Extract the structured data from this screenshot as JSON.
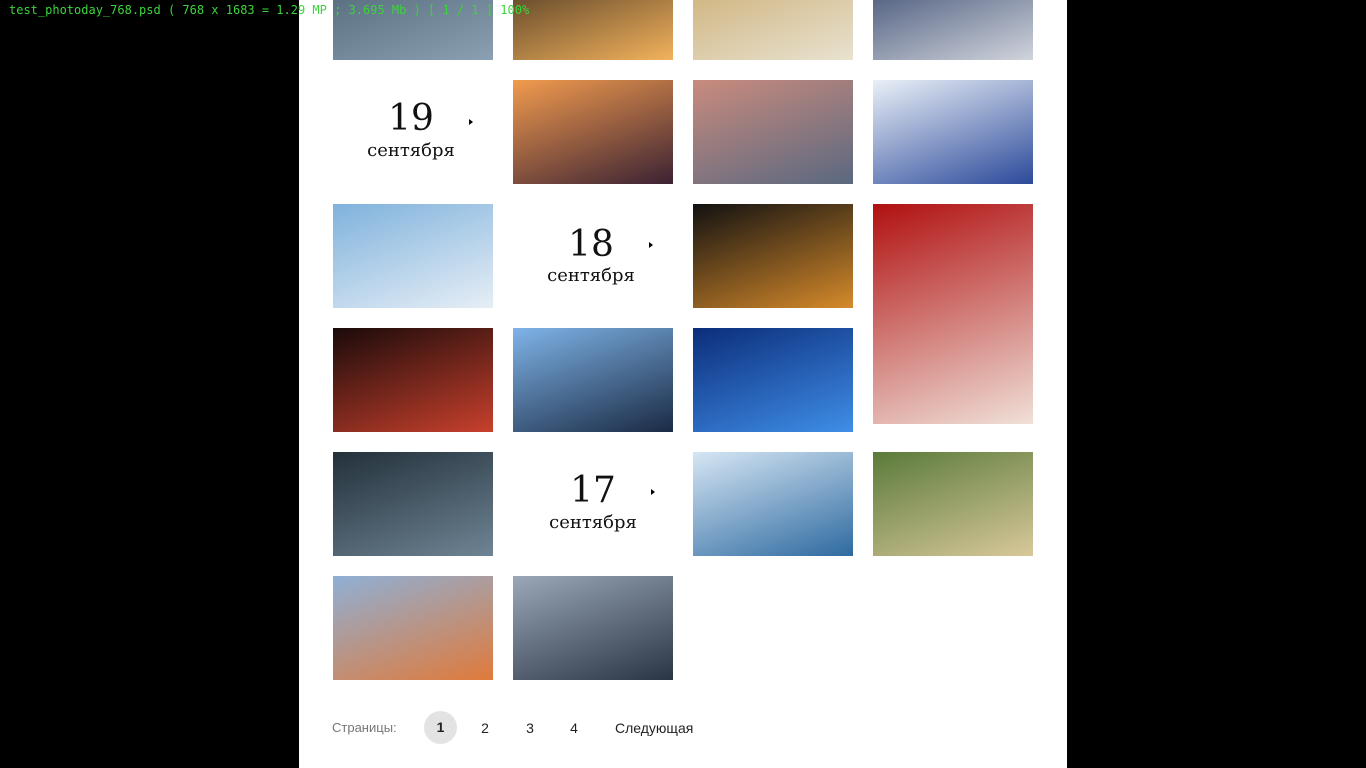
{
  "viewer": {
    "title": "test_photoday_768.psd  ( 768 x 1683 = 1.29 MP ;  3.695 Mb )  [ 1 / 1 ]   100%"
  },
  "dates": [
    {
      "day": "19",
      "month": "сентября"
    },
    {
      "day": "18",
      "month": "сентября"
    },
    {
      "day": "17",
      "month": "сентября"
    }
  ],
  "photos": [
    {
      "name": "rain-puddle-photo",
      "colors": [
        "#4a5f70",
        "#8ba0b2"
      ]
    },
    {
      "name": "grinder-sparks-photo",
      "colors": [
        "#3a2a1c",
        "#f2b25c"
      ]
    },
    {
      "name": "impressionist-street-photo",
      "colors": [
        "#c9a86a",
        "#e8e2d0"
      ]
    },
    {
      "name": "sound-engineer-photo",
      "colors": [
        "#2c3e66",
        "#d0d4dc"
      ]
    },
    {
      "name": "oil-pumps-sunset-photo",
      "colors": [
        "#f29b4e",
        "#3b2233"
      ]
    },
    {
      "name": "sea-platform-dusk-photo",
      "colors": [
        "#c98b7d",
        "#5a6880"
      ]
    },
    {
      "name": "airport-hall-people-photo",
      "colors": [
        "#eaf0f8",
        "#2c4a9a"
      ]
    },
    {
      "name": "mountain-glacier-photo",
      "colors": [
        "#7fb2dc",
        "#e6eef6"
      ]
    },
    {
      "name": "flamenco-dancers-photo",
      "colors": [
        "#111111",
        "#d68a2a"
      ]
    },
    {
      "name": "cola-cans-photo",
      "colors": [
        "#b01010",
        "#f0e0d8"
      ]
    },
    {
      "name": "night-light-trails-photo",
      "colors": [
        "#1a0a0a",
        "#c8402c"
      ]
    },
    {
      "name": "graduation-caps-photo",
      "colors": [
        "#7fb4e8",
        "#1a2a44"
      ]
    },
    {
      "name": "iceberg-moon-photo",
      "colors": [
        "#0b2d7a",
        "#3f8ee8"
      ]
    },
    {
      "name": "film-projector-photo",
      "colors": [
        "#22303a",
        "#6f8494"
      ]
    },
    {
      "name": "winter-couple-photo",
      "colors": [
        "#d6e6f4",
        "#2e6aa0"
      ]
    },
    {
      "name": "scooter-rider-photo",
      "colors": [
        "#5a7a3a",
        "#d8c89a"
      ]
    },
    {
      "name": "railway-station-dusk-photo",
      "colors": [
        "#8fb0d6",
        "#e07a3a"
      ]
    },
    {
      "name": "airport-woman-seat-photo",
      "colors": [
        "#9aa8b8",
        "#2a3444"
      ]
    }
  ],
  "pager": {
    "label": "Страницы:",
    "pages": [
      "1",
      "2",
      "3",
      "4"
    ],
    "current": "1",
    "next": "Следующая"
  }
}
